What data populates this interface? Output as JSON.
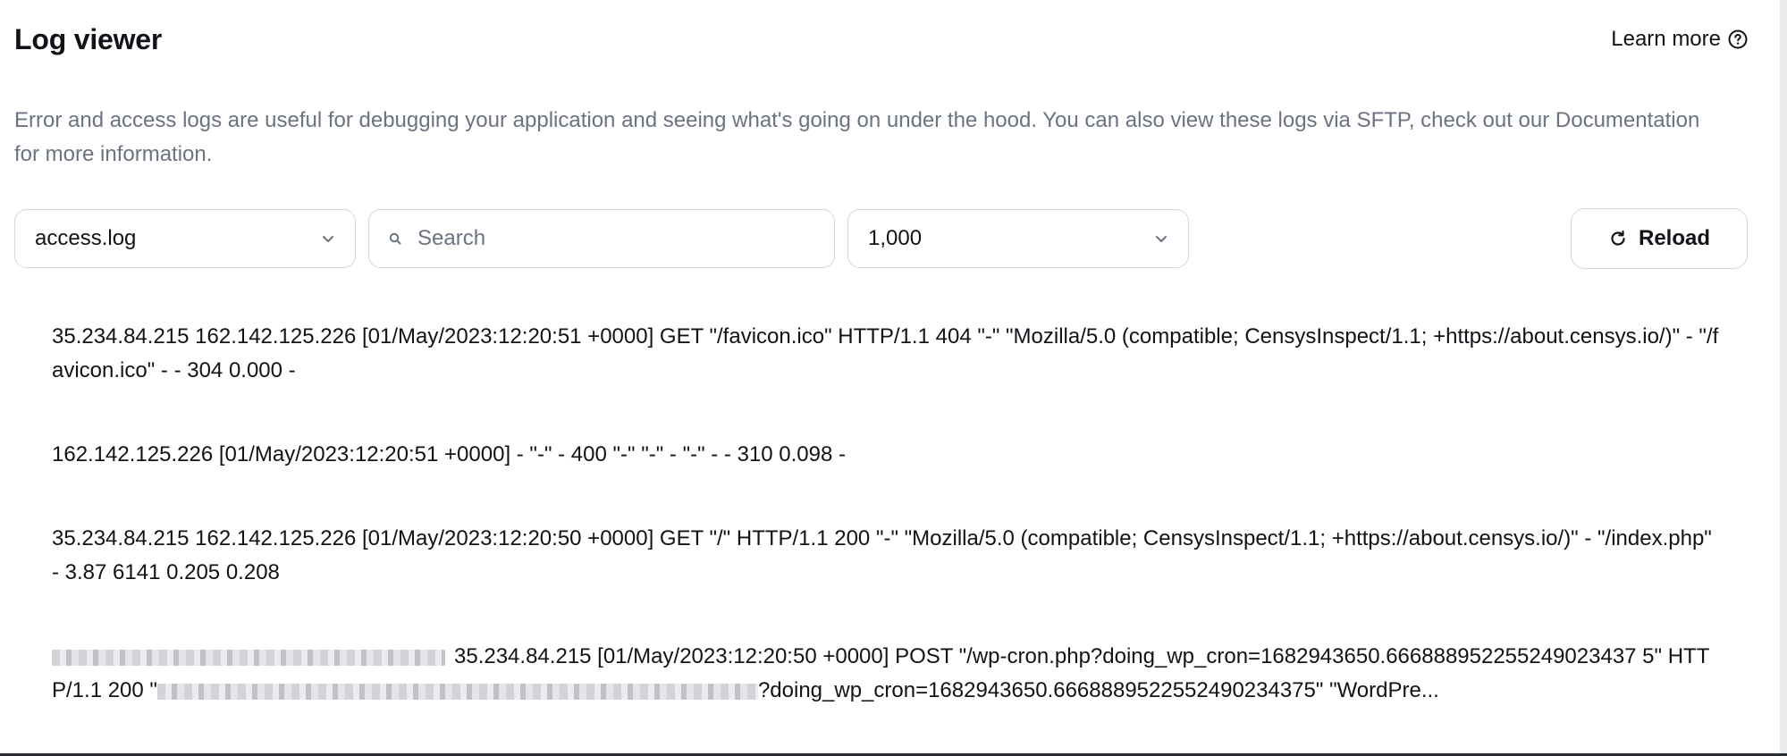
{
  "header": {
    "title": "Log viewer",
    "learn_more_label": "Learn more"
  },
  "description": "Error and access logs are useful for debugging your application and seeing what's going on under the hood. You can also view these logs via SFTP, check out our Documentation for more information.",
  "controls": {
    "file_select_value": "access.log",
    "search_placeholder": "Search",
    "search_value": "",
    "lines_select_value": "1,000",
    "reload_label": "Reload"
  },
  "logs": [
    "35.234.84.215 162.142.125.226 [01/May/2023:12:20:51 +0000] GET \"/favicon.ico\" HTTP/1.1 404 \"-\" \"Mozilla/5.0 (compatible; CensysInspect/1.1; +https://about.censys.io/)\" - \"/favicon.ico\" - - 304 0.000 -",
    "162.142.125.226 [01/May/2023:12:20:51 +0000] - \"-\" - 400 \"-\" \"-\" - \"-\" - - 310 0.098 -",
    "35.234.84.215 162.142.125.226 [01/May/2023:12:20:50 +0000] GET \"/\" HTTP/1.1 200 \"-\" \"Mozilla/5.0 (compatible; CensysInspect/1.1; +https://about.censys.io/)\" - \"/index.php\" - 3.87 6141 0.205 0.208"
  ],
  "log_4": {
    "part_a": "35.234.84.215 [01/May/2023:12:20:50 +0000] POST \"/wp-cron.php?doing_wp_cron=1682943650.666888952255249023437 5\" HTTP/1.1 200 \"",
    "part_b": "?doing_wp_cron=1682943650.6668889522552490234375\" \"WordPre..."
  },
  "icons": {
    "help": "help-circle-icon",
    "chevron": "chevron-down-icon",
    "search": "search-icon",
    "reload": "reload-icon"
  }
}
